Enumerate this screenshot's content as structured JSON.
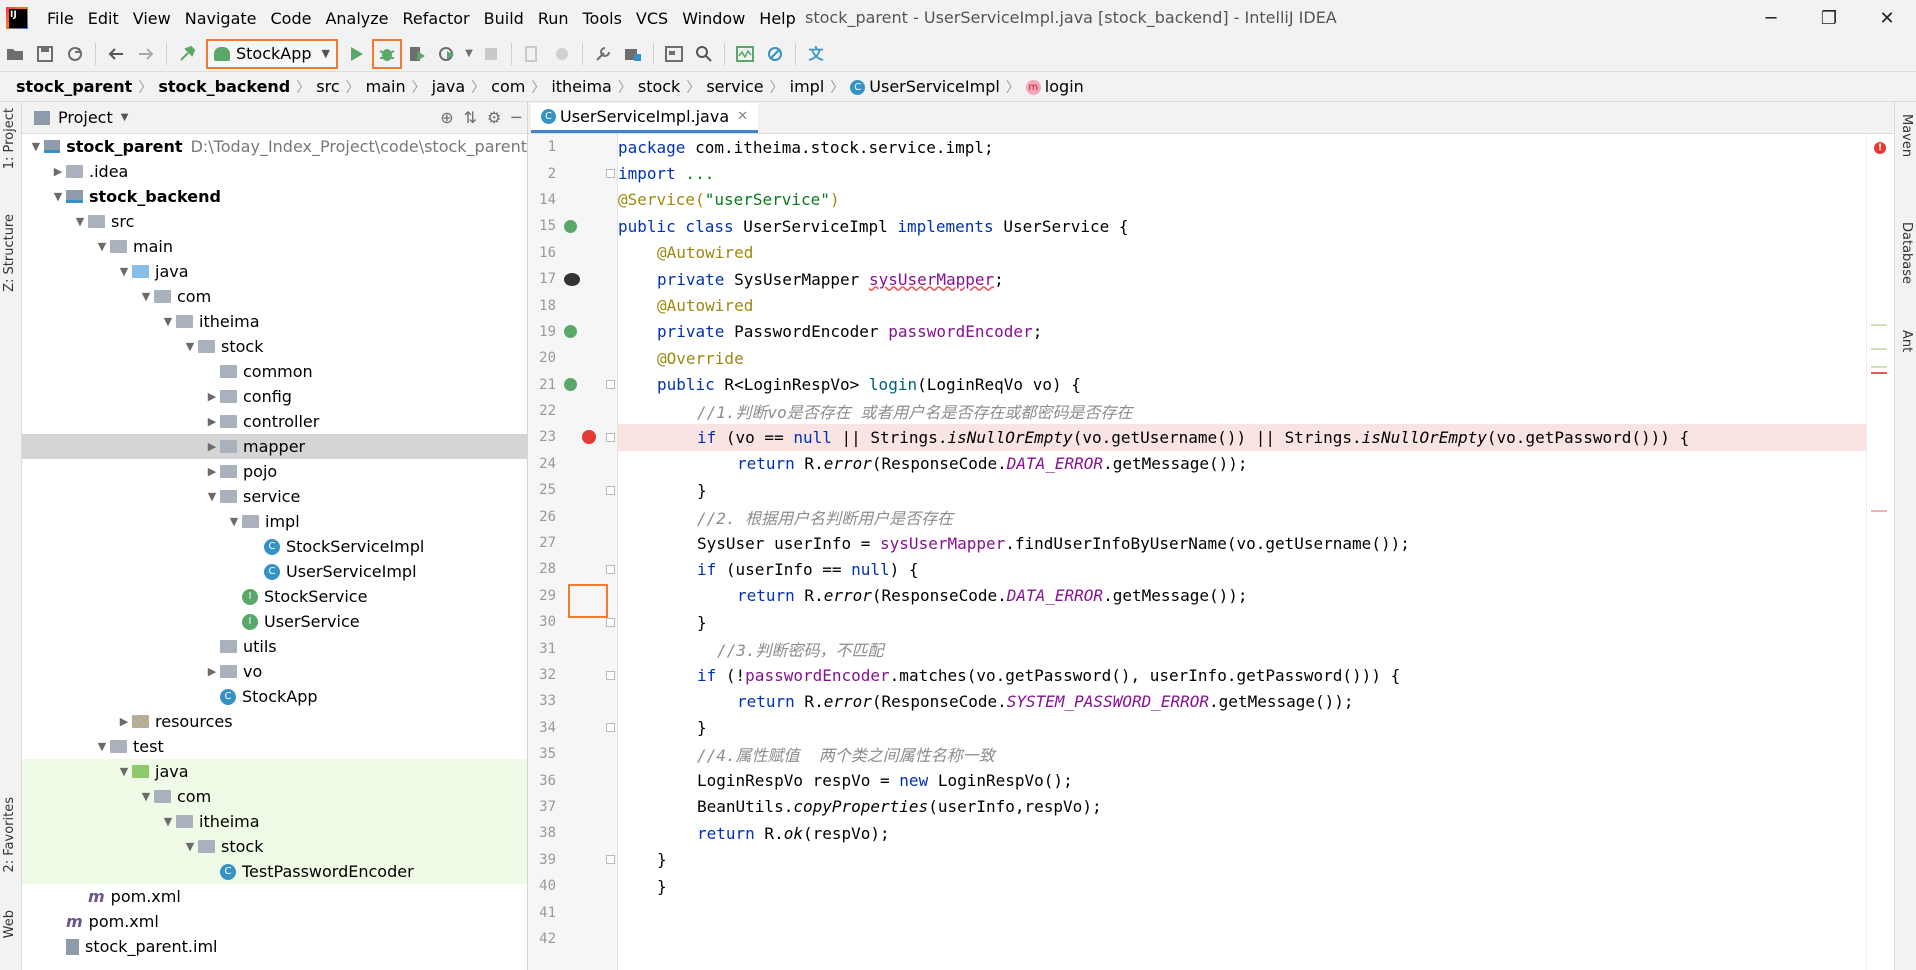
{
  "window": {
    "title": "stock_parent - UserServiceImpl.java [stock_backend] - IntelliJ IDEA",
    "menu": [
      "File",
      "Edit",
      "View",
      "Navigate",
      "Code",
      "Analyze",
      "Refactor",
      "Build",
      "Run",
      "Tools",
      "VCS",
      "Window",
      "Help"
    ],
    "controls": {
      "minimize": "─",
      "restore": "❐",
      "close": "✕"
    }
  },
  "toolbar": {
    "run_config": "StockApp"
  },
  "breadcrumb": [
    "stock_parent",
    "stock_backend",
    "src",
    "main",
    "java",
    "com",
    "itheima",
    "stock",
    "service",
    "impl",
    "UserServiceImpl",
    "login"
  ],
  "sidebars": {
    "left": [
      "1: Project",
      "Z: Structure",
      "2: Favorites",
      "Web"
    ],
    "right": [
      "Maven",
      "Database",
      "Ant"
    ]
  },
  "project": {
    "header": "Project",
    "root_name": "stock_parent",
    "root_path": "D:\\Today_Index_Project\\code\\stock_parent",
    "items": [
      {
        "label": ".idea",
        "level": 1,
        "arrow": "right",
        "icon": "folder"
      },
      {
        "label": "stock_backend",
        "level": 1,
        "arrow": "down",
        "icon": "module",
        "bold": true
      },
      {
        "label": "src",
        "level": 2,
        "arrow": "down",
        "icon": "folder"
      },
      {
        "label": "main",
        "level": 3,
        "arrow": "down",
        "icon": "folder"
      },
      {
        "label": "java",
        "level": 4,
        "arrow": "down",
        "icon": "src"
      },
      {
        "label": "com",
        "level": 5,
        "arrow": "down",
        "icon": "folder"
      },
      {
        "label": "itheima",
        "level": 6,
        "arrow": "down",
        "icon": "folder"
      },
      {
        "label": "stock",
        "level": 7,
        "arrow": "down",
        "icon": "folder"
      },
      {
        "label": "common",
        "level": 8,
        "arrow": "none",
        "icon": "folder"
      },
      {
        "label": "config",
        "level": 8,
        "arrow": "right",
        "icon": "folder"
      },
      {
        "label": "controller",
        "level": 8,
        "arrow": "right",
        "icon": "folder"
      },
      {
        "label": "mapper",
        "level": 8,
        "arrow": "right",
        "icon": "folder",
        "selected": true
      },
      {
        "label": "pojo",
        "level": 8,
        "arrow": "right",
        "icon": "folder"
      },
      {
        "label": "service",
        "level": 8,
        "arrow": "down",
        "icon": "folder"
      },
      {
        "label": "impl",
        "level": 9,
        "arrow": "down",
        "icon": "folder"
      },
      {
        "label": "StockServiceImpl",
        "level": 10,
        "arrow": "none",
        "icon": "class"
      },
      {
        "label": "UserServiceImpl",
        "level": 10,
        "arrow": "none",
        "icon": "class"
      },
      {
        "label": "StockService",
        "level": 9,
        "arrow": "none",
        "icon": "interface"
      },
      {
        "label": "UserService",
        "level": 9,
        "arrow": "none",
        "icon": "interface"
      },
      {
        "label": "utils",
        "level": 8,
        "arrow": "none",
        "icon": "folder"
      },
      {
        "label": "vo",
        "level": 8,
        "arrow": "right",
        "icon": "folder"
      },
      {
        "label": "StockApp",
        "level": 8,
        "arrow": "none",
        "icon": "class"
      },
      {
        "label": "resources",
        "level": 4,
        "arrow": "right",
        "icon": "res"
      },
      {
        "label": "test",
        "level": 3,
        "arrow": "down",
        "icon": "folder"
      },
      {
        "label": "java",
        "level": 4,
        "arrow": "down",
        "icon": "testsrc",
        "test": true
      },
      {
        "label": "com",
        "level": 5,
        "arrow": "down",
        "icon": "folder",
        "test": true
      },
      {
        "label": "itheima",
        "level": 6,
        "arrow": "down",
        "icon": "folder",
        "test": true
      },
      {
        "label": "stock",
        "level": 7,
        "arrow": "down",
        "icon": "folder",
        "test": true
      },
      {
        "label": "TestPasswordEncoder",
        "level": 8,
        "arrow": "none",
        "icon": "class",
        "test": true
      },
      {
        "label": "pom.xml",
        "level": 2,
        "arrow": "none",
        "icon": "maven"
      },
      {
        "label": "pom.xml",
        "level": 1,
        "arrow": "none",
        "icon": "maven"
      },
      {
        "label": "stock_parent.iml",
        "level": 1,
        "arrow": "none",
        "icon": "iml"
      }
    ]
  },
  "editor": {
    "tab": "UserServiceImpl.java",
    "line_numbers": [
      "1",
      "2",
      "14",
      "15",
      "16",
      "17",
      "18",
      "19",
      "20",
      "21",
      "22",
      "23",
      "24",
      "25",
      "26",
      "27",
      "28",
      "29",
      "30",
      "31",
      "32",
      "33",
      "34",
      "35",
      "36",
      "37",
      "38",
      "39",
      "40",
      "41",
      "42"
    ],
    "breakpoint_line": "23",
    "code": {
      "l1_kw": "package",
      "l1_rest": " com.itheima.stock.service.impl;",
      "l2_kw": "import",
      "l2_rest": " ...",
      "l3_ann": "@Service(",
      "l3_str": "\"userService\"",
      "l3_end": ")",
      "l4_kw": "public class",
      "l4_a": " UserServiceImpl ",
      "l4_kw2": "implements",
      "l4_b": " UserService {",
      "l5_ann": "@Autowired",
      "l6_kw": "private",
      "l6_a": " SysUserMapper ",
      "l6_fld": "sysUserMapper",
      "l6_end": ";",
      "l7_ann": "@Autowired",
      "l8_kw": "private",
      "l8_a": " PasswordEncoder ",
      "l8_fld": "passwordEncoder",
      "l8_end": ";",
      "l9_ann": "@Override",
      "l10_kw": "public",
      "l10_a": " R<LoginRespVo> ",
      "l10_mth": "login",
      "l10_b": "(LoginReqVo vo) {",
      "l11_cmt": "//1.判断vo是否存在 或者用户名是否存在或都密码是否存在",
      "l12_kw": "if",
      "l12_a": " (vo == ",
      "l12_kw2": "null",
      "l12_b": " || Strings.",
      "l12_it": "isNullOrEmpty",
      "l12_c": "(vo.getUsername()) || Strings.",
      "l12_it2": "isNullOrEmpty",
      "l12_d": "(vo.getPassword())) {",
      "l13_kw": "return",
      "l13_a": " R.",
      "l13_it": "error",
      "l13_b": "(ResponseCode.",
      "l13_const": "DATA_ERROR",
      "l13_c": ".getMessage());",
      "l14": "}",
      "l15_cmt": "//2. 根据用户名判断用户是否存在",
      "l16_a": "SysUser userInfo = ",
      "l16_fld": "sysUserMapper",
      "l16_b": ".findUserInfoByUserName(vo.getUsername());",
      "l17_kw": "if",
      "l17_a": " (userInfo == ",
      "l17_kw2": "null",
      "l17_b": ") {",
      "l18_kw": "return",
      "l18_a": " R.",
      "l18_it": "error",
      "l18_b": "(ResponseCode.",
      "l18_const": "DATA_ERROR",
      "l18_c": ".getMessage());",
      "l19": "}",
      "l20_cmt": "//3.判断密码，不匹配",
      "l21_kw": "if",
      "l21_a": " (!",
      "l21_fld": "passwordEncoder",
      "l21_b": ".matches(vo.getPassword(), userInfo.getPassword())) {",
      "l22_kw": "return",
      "l22_a": " R.",
      "l22_it": "error",
      "l22_b": "(ResponseCode.",
      "l22_const": "SYSTEM_PASSWORD_ERROR",
      "l22_c": ".getMessage());",
      "l23": "}",
      "l24_cmt": "//4.属性赋值  两个类之间属性名称一致",
      "l25_a": "LoginRespVo respVo = ",
      "l25_kw": "new",
      "l25_b": " LoginRespVo();",
      "l26_a": "BeanUtils.",
      "l26_it": "copyProperties",
      "l26_b": "(userInfo,respVo);",
      "l27_kw": "return",
      "l27_a": " R.",
      "l27_it": "ok",
      "l27_b": "(respVo);",
      "l28": "}",
      "l29": "}"
    }
  }
}
